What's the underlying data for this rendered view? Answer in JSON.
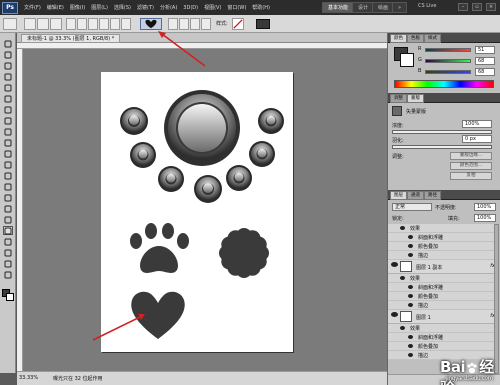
{
  "app": {
    "logo": "Ps",
    "title_window_label": "CS Live"
  },
  "menubar": {
    "items": [
      "文件(F)",
      "编辑(E)",
      "图像(I)",
      "图层(L)",
      "选择(S)",
      "滤镜(T)",
      "分析(A)",
      "3D(D)",
      "视图(V)",
      "窗口(W)",
      "帮助(H)"
    ],
    "zoom": "33.3",
    "workspace_buttons": [
      "基本功能",
      "设计",
      "绘画"
    ],
    "active_workspace": "基本功能",
    "more": "»"
  },
  "options_bar": {
    "style_label": "样式:",
    "selected_shape": "heart-shape",
    "shape_color": "#383838"
  },
  "document": {
    "tab_title": "未标题-1 @ 33.3% (图层 1, RGB/8) *",
    "zoom_status": "33.33%",
    "doc_size": "曝光只在 32 位起作用",
    "arrow_color": "#d32020"
  },
  "canvas": {
    "background": "#7b7b7b",
    "paper": "#ffffff",
    "shapes_color": "#3a3a3a"
  },
  "color_panel": {
    "tabs": [
      "颜色",
      "色板",
      "样式"
    ],
    "channels": [
      {
        "label": "R",
        "value": "51"
      },
      {
        "label": "G",
        "value": "68"
      },
      {
        "label": "B",
        "value": "68"
      }
    ]
  },
  "adjustments_panel": {
    "tabs": [
      "调整",
      "蒙版"
    ],
    "title": "矢量蒙版",
    "density_label": "浓度:",
    "density_value": "100%",
    "feather_label": "羽化:",
    "feather_value": "0 px",
    "refine_label": "调整:",
    "buttons": [
      "蒙版边缘...",
      "颜色范围...",
      "反相"
    ]
  },
  "layers_panel": {
    "tabs": [
      "图层",
      "通道",
      "路径"
    ],
    "blend_mode": "正常",
    "opacity_label": "不透明度:",
    "opacity_value": "100%",
    "lock_label": "锁定:",
    "fill_label": "填充:",
    "fill_value": "100%",
    "layers": [
      {
        "name": "效果",
        "kind": "sub"
      },
      {
        "name": "斜面和浮雕",
        "kind": "effect"
      },
      {
        "name": "颜色叠加",
        "kind": "effect"
      },
      {
        "name": "描边",
        "kind": "effect"
      },
      {
        "name": "图层 1 副本",
        "kind": "layer",
        "fx": "fx"
      },
      {
        "name": "效果",
        "kind": "sub"
      },
      {
        "name": "斜面和浮雕",
        "kind": "effect"
      },
      {
        "name": "颜色叠加",
        "kind": "effect"
      },
      {
        "name": "描边",
        "kind": "effect"
      },
      {
        "name": "图层 1",
        "kind": "layer",
        "fx": "fx"
      },
      {
        "name": "效果",
        "kind": "sub"
      },
      {
        "name": "斜面和浮雕",
        "kind": "effect"
      },
      {
        "name": "颜色叠加",
        "kind": "effect"
      },
      {
        "name": "描边",
        "kind": "effect"
      }
    ]
  },
  "watermark": {
    "text_left": "Bai",
    "text_right": "经验",
    "sub": "jingyan.baidu.com"
  }
}
